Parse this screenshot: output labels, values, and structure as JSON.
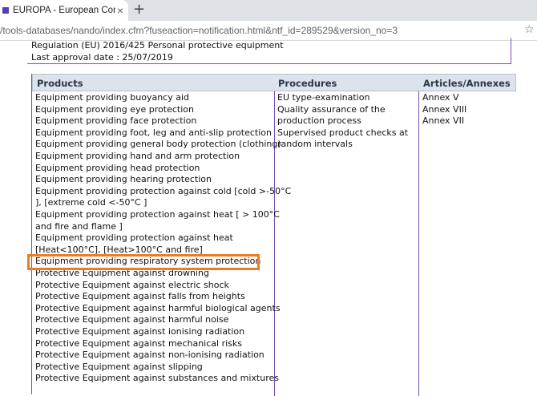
{
  "browser": {
    "tab_title": "EUROPA - European Commission",
    "tab_close": "×",
    "new_tab": "+",
    "url": "/tools-databases/nando/index.cfm?fuseaction=notification.html&ntf_id=289529&version_no=3",
    "star": "☆"
  },
  "regulation": {
    "title": "Regulation (EU) 2016/425 Personal protective equipment",
    "approval": "Last approval date : 25/07/2019"
  },
  "table": {
    "headers": {
      "products": "Products",
      "procedures": "Procedures",
      "annexes": "Articles/Annexes"
    },
    "products": [
      "Equipment providing buoyancy aid",
      "Equipment providing eye protection",
      "Equipment providing face protection",
      "Equipment providing foot, leg and anti-slip protection",
      "Equipment providing general body protection (clothing)",
      "Equipment providing hand and arm protection",
      "Equipment providing head protection",
      "Equipment providing hearing protection",
      "Equipment providing protection against cold [cold >-50°C",
      "], [extreme cold <-50°C ]",
      "Equipment providing protection against heat [ > 100°C",
      "and fire and flame ]",
      "Equipment providing protection against heat",
      "[Heat<100°C], [Heat>100°C and fire]",
      "Equipment providing respiratory system protection",
      "Protective Equipment against drowning",
      "Protective Equipment against electric shock",
      "Protective Equipment against falls from heights",
      "Protective Equipment against harmful biological agents",
      "Protective Equipment against harmful noise",
      "Protective Equipment against ionising radiation",
      "Protective Equipment against mechanical risks",
      "Protective Equipment against non-ionising radiation",
      "Protective Equipment against slipping",
      "Protective Equipment against substances and mixtures"
    ],
    "procedures": [
      "EU type-examination",
      "Quality assurance of the",
      "production process",
      "Supervised product checks at",
      "random intervals"
    ],
    "annexes": [
      "Annex V",
      "Annex VIII",
      "Annex VII"
    ]
  },
  "colors": {
    "highlight": "#f07a23",
    "border": "#7b4fb0",
    "header_bg": "#dde3ec"
  }
}
